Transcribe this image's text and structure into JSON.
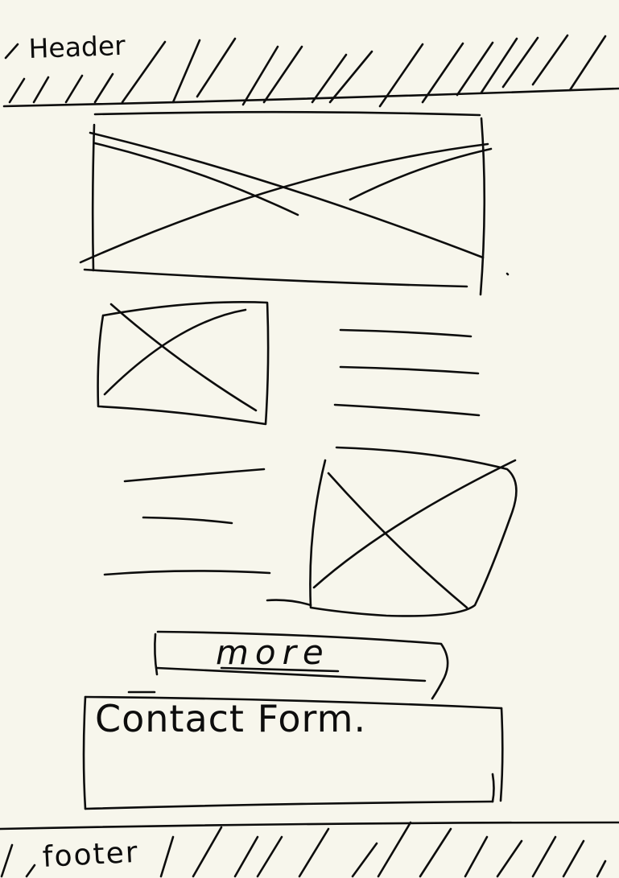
{
  "header": {
    "label": "Header"
  },
  "more_button": {
    "label": "more"
  },
  "contact_form": {
    "label": "Contact Form."
  },
  "footer": {
    "label": "footer"
  },
  "colors": {
    "background": "#f7f6ec",
    "ink": "#0d0d0d"
  }
}
